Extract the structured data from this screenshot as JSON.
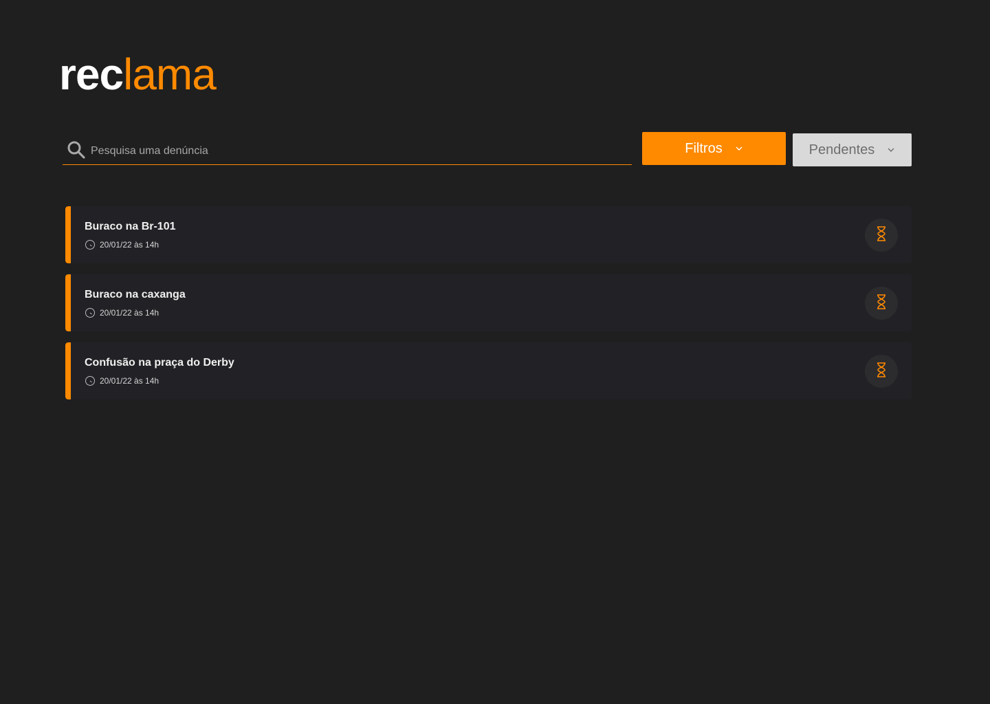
{
  "brand": {
    "part1": "rec",
    "part2": "lama"
  },
  "search": {
    "placeholder": "Pesquisa uma denúncia",
    "value": ""
  },
  "filters": {
    "filtros_label": "Filtros",
    "status_label": "Pendentes"
  },
  "colors": {
    "accent": "#ff8a00",
    "background": "#1f1f1f",
    "card": "#222226"
  },
  "complaints": [
    {
      "title": "Buraco na Br-101",
      "date": "20/01/22 às 14h",
      "status_icon": "hourglass-icon"
    },
    {
      "title": "Buraco na caxanga",
      "date": "20/01/22 às 14h",
      "status_icon": "hourglass-icon"
    },
    {
      "title": "Confusão na praça do Derby",
      "date": "20/01/22 às 14h",
      "status_icon": "hourglass-icon"
    }
  ]
}
